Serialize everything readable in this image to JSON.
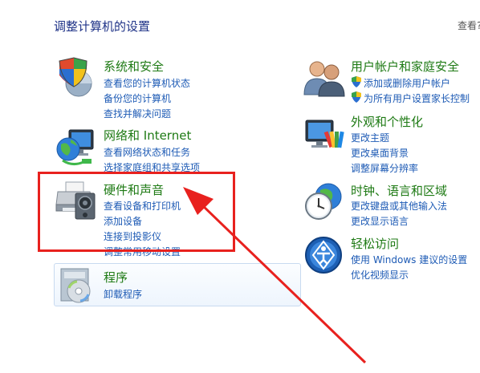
{
  "header": {
    "title": "调整计算机的设置",
    "view_by": "查看?"
  },
  "left_column": [
    {
      "title": "系统和安全",
      "icon": "shield-icon",
      "links": [
        "查看您的计算机状态",
        "备份您的计算机",
        "查找并解决问题"
      ]
    },
    {
      "title": "网络和 Internet",
      "icon": "network-globe-icon",
      "links": [
        "查看网络状态和任务",
        "选择家庭组和共享选项"
      ]
    },
    {
      "title": "硬件和声音",
      "icon": "printer-speaker-icon",
      "links": [
        "查看设备和打印机",
        "添加设备",
        "连接到投影仪",
        "调整常用移动设置"
      ]
    },
    {
      "title": "程序",
      "icon": "programs-icon",
      "links": [
        "卸载程序"
      ]
    }
  ],
  "right_column": [
    {
      "title": "用户帐户和家庭安全",
      "icon": "users-icon",
      "links": [
        "添加或删除用户帐户",
        "为所有用户设置家长控制"
      ]
    },
    {
      "title": "外观和个性化",
      "icon": "monitor-paint-icon",
      "links": [
        "更改主题",
        "更改桌面背景",
        "调整屏幕分辨率"
      ]
    },
    {
      "title": "时钟、语言和区域",
      "icon": "clock-globe-icon",
      "links": [
        "更改键盘或其他输入法",
        "更改显示语言"
      ]
    },
    {
      "title": "轻松访问",
      "icon": "accessibility-icon",
      "links": [
        "使用 Windows 建议的设置",
        "优化视频显示"
      ]
    }
  ],
  "annotation": {
    "color": "#e8211e"
  }
}
